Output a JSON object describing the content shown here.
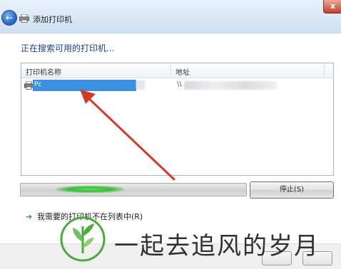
{
  "window": {
    "title": "添加打印机",
    "close_label": "x"
  },
  "heading": "正在搜索可用的打印机...",
  "list": {
    "columns": [
      "打印机名称",
      "地址"
    ],
    "rows": [
      {
        "name": "Pc",
        "address": "\\\\"
      }
    ]
  },
  "search": {
    "stop_label": "停止(S)"
  },
  "link": {
    "label": "我需要的打印机不在列表中(R)"
  },
  "watermark": {
    "text": "一起去追风的岁月"
  },
  "colors": {
    "selection": "#3d8fe2",
    "heading": "#1d3f8c",
    "annotation_arrow": "#d23a2a",
    "progress_glow": "#3bbb3b"
  },
  "icons": {
    "back": "back-arrow-icon",
    "title": "printer-icon",
    "row": "printer-icon",
    "link": "green-arrow-icon"
  }
}
